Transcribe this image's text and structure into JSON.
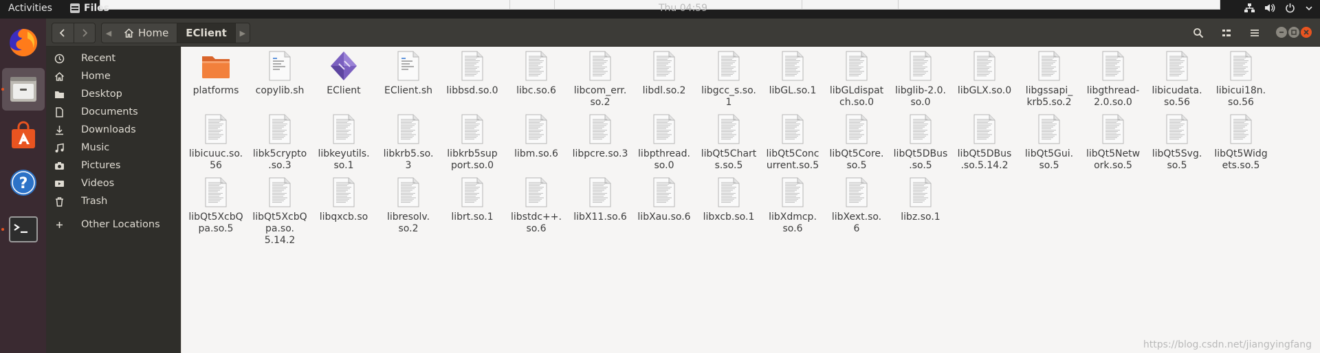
{
  "topbar": {
    "activities": "Activities",
    "app_name": "Files",
    "clock": "Thu 04:59"
  },
  "headerbar": {
    "back_icon": "chevron-left-icon",
    "forward_icon": "chevron-right-icon",
    "crumbs": [
      {
        "label": "Home",
        "icon": "home-icon"
      },
      {
        "label": "EClient"
      }
    ]
  },
  "sidebar": {
    "items": [
      {
        "label": "Recent",
        "icon": "clock-icon"
      },
      {
        "label": "Home",
        "icon": "home-icon"
      },
      {
        "label": "Desktop",
        "icon": "folder-icon"
      },
      {
        "label": "Documents",
        "icon": "document-icon"
      },
      {
        "label": "Downloads",
        "icon": "download-icon"
      },
      {
        "label": "Music",
        "icon": "music-icon"
      },
      {
        "label": "Pictures",
        "icon": "camera-icon"
      },
      {
        "label": "Videos",
        "icon": "video-icon"
      },
      {
        "label": "Trash",
        "icon": "trash-icon"
      },
      {
        "label": "Other Locations",
        "icon": "plus-icon"
      }
    ]
  },
  "files": [
    {
      "name": "platforms",
      "kind": "folder"
    },
    {
      "name": "copylib.sh",
      "kind": "script"
    },
    {
      "name": "EClient",
      "kind": "exec"
    },
    {
      "name": "EClient.sh",
      "kind": "script"
    },
    {
      "name": "libbsd.so.0",
      "kind": "lib"
    },
    {
      "name": "libc.so.6",
      "kind": "lib"
    },
    {
      "name": "libcom_err.\nso.2",
      "kind": "lib"
    },
    {
      "name": "libdl.so.2",
      "kind": "lib"
    },
    {
      "name": "libgcc_s.so.\n1",
      "kind": "lib"
    },
    {
      "name": "libGL.so.1",
      "kind": "lib"
    },
    {
      "name": "libGLdispat\nch.so.0",
      "kind": "lib"
    },
    {
      "name": "libglib-2.0.\nso.0",
      "kind": "lib"
    },
    {
      "name": "libGLX.so.0",
      "kind": "lib"
    },
    {
      "name": "libgssapi_\nkrb5.so.2",
      "kind": "lib"
    },
    {
      "name": "libgthread-\n2.0.so.0",
      "kind": "lib"
    },
    {
      "name": "libicudata.\nso.56",
      "kind": "lib"
    },
    {
      "name": "libicui18n.\nso.56",
      "kind": "lib"
    },
    {
      "name": "libicuuc.so.\n56",
      "kind": "lib"
    },
    {
      "name": "libk5crypto\n.so.3",
      "kind": "lib"
    },
    {
      "name": "libkeyutils.\nso.1",
      "kind": "lib"
    },
    {
      "name": "libkrb5.so.\n3",
      "kind": "lib"
    },
    {
      "name": "libkrb5sup\nport.so.0",
      "kind": "lib"
    },
    {
      "name": "libm.so.6",
      "kind": "lib"
    },
    {
      "name": "libpcre.so.3",
      "kind": "lib"
    },
    {
      "name": "libpthread.\nso.0",
      "kind": "lib"
    },
    {
      "name": "libQt5Chart\ns.so.5",
      "kind": "lib"
    },
    {
      "name": "libQt5Conc\nurrent.so.5",
      "kind": "lib"
    },
    {
      "name": "libQt5Core.\nso.5",
      "kind": "lib"
    },
    {
      "name": "libQt5DBus\n.so.5",
      "kind": "lib"
    },
    {
      "name": "libQt5DBus\n.so.5.14.2",
      "kind": "lib"
    },
    {
      "name": "libQt5Gui.\nso.5",
      "kind": "lib"
    },
    {
      "name": "libQt5Netw\nork.so.5",
      "kind": "lib"
    },
    {
      "name": "libQt5Svg.\nso.5",
      "kind": "lib"
    },
    {
      "name": "libQt5Widg\nets.so.5",
      "kind": "lib"
    },
    {
      "name": "libQt5XcbQ\npa.so.5",
      "kind": "lib"
    },
    {
      "name": "libQt5XcbQ\npa.so.\n5.14.2",
      "kind": "lib"
    },
    {
      "name": "libqxcb.so",
      "kind": "lib"
    },
    {
      "name": "libresolv.\nso.2",
      "kind": "lib"
    },
    {
      "name": "librt.so.1",
      "kind": "lib"
    },
    {
      "name": "libstdc++.\nso.6",
      "kind": "lib"
    },
    {
      "name": "libX11.so.6",
      "kind": "lib"
    },
    {
      "name": "libXau.so.6",
      "kind": "lib"
    },
    {
      "name": "libxcb.so.1",
      "kind": "lib"
    },
    {
      "name": "libXdmcp.\nso.6",
      "kind": "lib"
    },
    {
      "name": "libXext.so.\n6",
      "kind": "lib"
    },
    {
      "name": "libz.so.1",
      "kind": "lib"
    }
  ],
  "watermark": "https://blog.csdn.net/jiangyingfang",
  "colors": {
    "folder": "#f2803c",
    "accent": "#e95420",
    "exec": "#7a5fbf"
  }
}
